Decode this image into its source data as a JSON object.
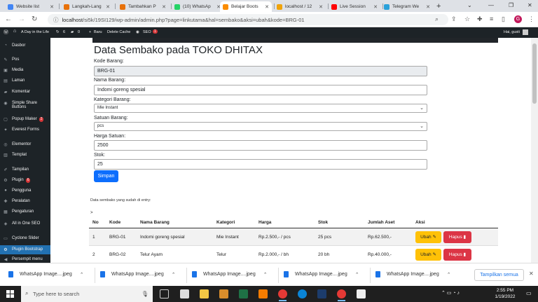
{
  "browser": {
    "tabs": [
      {
        "label": "Website list",
        "color": "#4285f4",
        "active": false
      },
      {
        "label": "Langkah-Lang",
        "color": "#e8710a",
        "active": false
      },
      {
        "label": "Tambahkan P",
        "color": "#e8710a",
        "active": false
      },
      {
        "label": "(10) WhatsAp",
        "color": "#25d366",
        "active": false
      },
      {
        "label": "Belajar Boots",
        "color": "#fb8c00",
        "active": true
      },
      {
        "label": "localhost / 12",
        "color": "#f0a30a",
        "active": false
      },
      {
        "label": "Live Session",
        "color": "#ff0000",
        "active": false
      },
      {
        "label": "Telegram We",
        "color": "#2aa1da",
        "active": false
      }
    ],
    "tab_close": "✕",
    "new_tab": "+",
    "url_host": "localhost",
    "url_path": "/si5k/19SI129/wp-admin/admin.php?page=linkutama&hal=sembako&aksi=ubah&kode=BRG-01",
    "profile_initial": "G",
    "window_controls": [
      "—",
      "❐",
      "✕"
    ]
  },
  "adminbar": {
    "site_name": "A Day in the Life",
    "updates": "6",
    "comments": "0",
    "new_label": "Baru",
    "delete_cache": "Delete Cache",
    "seo_label": "SEO",
    "seo_count": "1",
    "greeting": "Hai, gusti"
  },
  "sidebar": {
    "items": [
      {
        "label": "Dasbor",
        "icon": "dashboard-icon",
        "glyph": "◔"
      },
      {
        "label": "Pos",
        "icon": "pin-icon",
        "glyph": "✎"
      },
      {
        "label": "Media",
        "icon": "media-icon",
        "glyph": "▣"
      },
      {
        "label": "Laman",
        "icon": "page-icon",
        "glyph": "▤"
      },
      {
        "label": "Komentar",
        "icon": "comment-icon",
        "glyph": "▰"
      },
      {
        "label": "Simple Share",
        "label2": "Buttons",
        "icon": "share-icon",
        "glyph": "◉"
      },
      {
        "label": "Popup Maker",
        "badge": "2",
        "icon": "popup-icon",
        "glyph": "▢"
      },
      {
        "label": "Everest Forms",
        "icon": "forms-icon",
        "glyph": "✦"
      },
      {
        "label": "Elementor",
        "icon": "elementor-icon",
        "glyph": "◎"
      },
      {
        "label": "Templat",
        "icon": "template-icon",
        "glyph": "▥"
      },
      {
        "label": "Tampilan",
        "icon": "appearance-icon",
        "glyph": "✐"
      },
      {
        "label": "Plugin",
        "badge": "6",
        "icon": "plugin-icon",
        "glyph": "⚙"
      },
      {
        "label": "Pengguna",
        "icon": "users-icon",
        "glyph": "●"
      },
      {
        "label": "Peralatan",
        "icon": "tools-icon",
        "glyph": "✚"
      },
      {
        "label": "Pengaturan",
        "icon": "settings-icon",
        "glyph": "▦"
      },
      {
        "label": "All in One SEO",
        "icon": "seo-icon",
        "glyph": "◈"
      },
      {
        "label": "Cyclone Slider",
        "icon": "slider-icon",
        "glyph": "▭"
      },
      {
        "label": "Plugin Bootstrap",
        "icon": "bootstrap-icon",
        "glyph": "⚙",
        "active": true
      },
      {
        "label": "Persempit menu",
        "icon": "collapse-icon",
        "glyph": "◀"
      }
    ]
  },
  "form": {
    "title": "Data Sembako pada TOKO DHITAX",
    "kode_label": "Kode Barang:",
    "kode_value": "BRG-01",
    "nama_label": "Nama Barang:",
    "nama_value": "Indomi goreng spesial",
    "kategori_label": "Kategori Barang:",
    "kategori_value": "Mie Instant",
    "satuan_label": "Satuan Barang:",
    "satuan_value": "pcs",
    "harga_label": "Harga Satuan:",
    "harga_value": "2500",
    "stok_label": "Stok:",
    "stok_value": "25",
    "submit_label": "Simpan"
  },
  "table": {
    "note": "Data sembako yang sudah di entry:",
    "marker": ">",
    "headers": [
      "No",
      "Kode",
      "Nama Barang",
      "Kategori",
      "Harga",
      "Stok",
      "Jumlah Aset",
      "Aksi"
    ],
    "rows": [
      {
        "no": "1",
        "kode": "BRG-01",
        "nama": "Indomi goreng spesial",
        "kategori": "Mie Instant",
        "harga": "Rp.2.500,- / pcs",
        "stok": "25 pcs",
        "aset": "Rp.62.500,-"
      },
      {
        "no": "2",
        "kode": "BRG-02",
        "nama": "Telur Ayam",
        "kategori": "Telur",
        "harga": "Rp.2.000,- / bh",
        "stok": "20 bh",
        "aset": "Rp.40.000,-"
      }
    ],
    "edit_label": "Ubah",
    "delete_label": "Hapus"
  },
  "downloads": {
    "items": [
      "WhatsApp Image....jpeg",
      "WhatsApp Image....jpeg",
      "WhatsApp Image....jpeg",
      "WhatsApp Image....jpeg",
      "WhatsApp Image....jpeg"
    ],
    "show_all": "Tampilkan semua",
    "close": "✕"
  },
  "taskbar": {
    "search_placeholder": "Type here to search",
    "time": "2:55 PM",
    "date": "1/19/2022"
  }
}
